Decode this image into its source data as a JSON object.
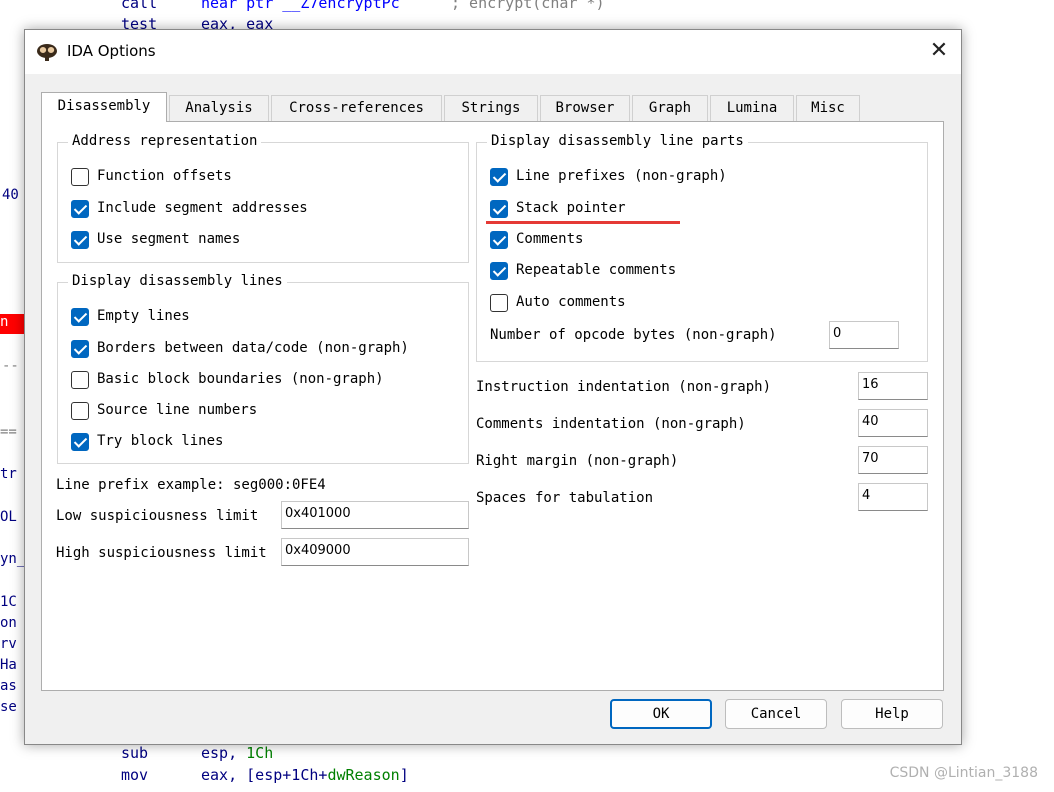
{
  "background": {
    "top_lines": [
      {
        "mnemonic": "call",
        "operand": "near ptr __Z7encryptPc",
        "comment": "; encrypt(char *)"
      },
      {
        "mnemonic": "test",
        "operand": "eax, eax",
        "comment": ""
      }
    ],
    "bottom_lines": [
      {
        "mnemonic": "sub",
        "operand_a": "esp, ",
        "operand_b": "1Ch"
      },
      {
        "mnemonic": "mov",
        "operand_a": "eax, [esp+1Ch+",
        "operand_b": "dwReason",
        "operand_c": "]"
      }
    ],
    "left_fragments": [
      "40",
      "n",
      "--",
      "==",
      "tr",
      "OL",
      "yn_",
      "1C",
      "on",
      "rv",
      "Ha",
      "as",
      "se"
    ],
    "watermark": "CSDN @Lintian_3188"
  },
  "dialog": {
    "title": "IDA Options",
    "close_glyph": "✕",
    "tabs": [
      "Disassembly",
      "Analysis",
      "Cross-references",
      "Strings",
      "Browser",
      "Graph",
      "Lumina",
      "Misc"
    ],
    "active_tab": "Disassembly",
    "address_representation": {
      "legend": "Address representation",
      "options": [
        {
          "label": "Function offsets",
          "checked": false
        },
        {
          "label": "Include segment addresses",
          "checked": true
        },
        {
          "label": "Use segment names",
          "checked": true
        }
      ]
    },
    "display_lines": {
      "legend": "Display disassembly lines",
      "options": [
        {
          "label": "Empty lines",
          "checked": true
        },
        {
          "label": "Borders between data/code (non-graph)",
          "checked": true
        },
        {
          "label": "Basic block boundaries (non-graph)",
          "checked": false
        },
        {
          "label": "Source line numbers",
          "checked": false
        },
        {
          "label": "Try block lines",
          "checked": true
        }
      ]
    },
    "line_prefix_example": "Line prefix example: seg000:0FE4",
    "low_limit": {
      "label": "Low suspiciousness limit",
      "value": "0x401000"
    },
    "high_limit": {
      "label": "High suspiciousness limit",
      "value": "0x409000"
    },
    "line_parts": {
      "legend": "Display disassembly line parts",
      "options": [
        {
          "label": "Line prefixes (non-graph)",
          "checked": true
        },
        {
          "label": "Stack pointer",
          "checked": true
        },
        {
          "label": "Comments",
          "checked": true
        },
        {
          "label": "Repeatable comments",
          "checked": true
        },
        {
          "label": "Auto comments",
          "checked": false
        }
      ],
      "opcode_bytes": {
        "label": "Number of opcode bytes (non-graph)",
        "value": "0"
      }
    },
    "indentation": [
      {
        "label": "Instruction indentation (non-graph)",
        "value": "16"
      },
      {
        "label": "Comments indentation (non-graph)",
        "value": "40"
      },
      {
        "label": "Right margin (non-graph)",
        "value": "70"
      },
      {
        "label": "Spaces for tabulation",
        "value": "4"
      }
    ],
    "buttons": {
      "ok": "OK",
      "cancel": "Cancel",
      "help": "Help"
    },
    "annotation_color": "#e53935",
    "accent_color": "#0067c0"
  }
}
